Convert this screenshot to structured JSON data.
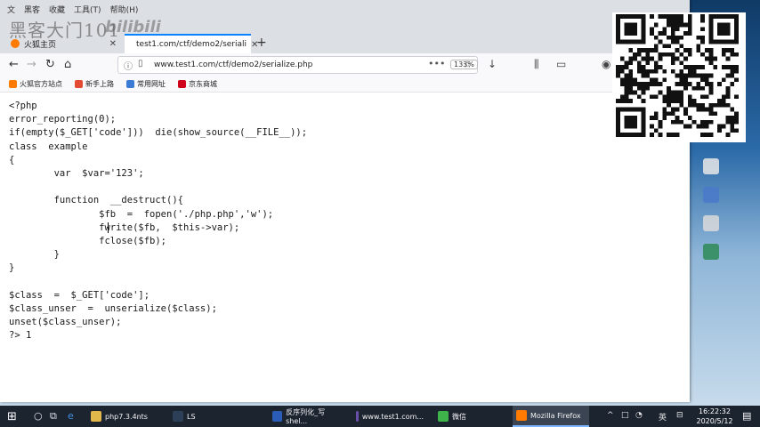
{
  "window": {
    "menu": [
      "文",
      "黑客",
      "收藏",
      "工具(T)",
      "帮助(H)"
    ],
    "watermark": "黑客大门101",
    "watermark_logo": "bilibili"
  },
  "tabs": [
    {
      "label": "火狐主页",
      "active": false,
      "icon": "firefox-icon"
    },
    {
      "label": "test1.com/ctf/demo2/seriali",
      "active": true,
      "icon": "page-icon"
    }
  ],
  "navbar": {
    "url": "www.test1.com/ctf/demo2/serialize.php",
    "zoom": "133%",
    "dots": "•••"
  },
  "bookmarks": [
    {
      "label": "火狐官方站点",
      "color": "#ff7a00"
    },
    {
      "label": "新手上路",
      "color": "#e34b32"
    },
    {
      "label": "常用网址",
      "color": "#3c7bd4"
    },
    {
      "label": "京东商城",
      "color": "#d0021b"
    }
  ],
  "code_lines": [
    "<?php",
    "error_reporting(0);",
    "if(empty($_GET['code']))  die(show_source(__FILE__));",
    "class  example",
    "{",
    "        var  $var='123';",
    "",
    "        function  __destruct(){",
    "                $fb  =  fopen('./php.php','w');",
    "                fwrite($fb,  $this->var);",
    "                fclose($fb);",
    "        }",
    "}",
    "",
    "$class  =  $_GET['code'];",
    "$class_unser  =  unserialize($class);",
    "unset($class_unser);",
    "?> 1"
  ],
  "taskbar": {
    "apps": [
      {
        "label": "php7.3.4nts",
        "color": "#e2b84a",
        "active": false
      },
      {
        "label": "LS",
        "color": "#2d3e58",
        "active": false
      },
      {
        "label": "反序列化_写shel...",
        "color": "#2b5db8",
        "active": false
      },
      {
        "label": "www.test1.com...",
        "color": "#6a4fa8",
        "active": false
      },
      {
        "label": "微信",
        "color": "#3db34a",
        "active": false
      },
      {
        "label": "Mozilla Firefox",
        "color": "#ff7a00",
        "active": true
      }
    ],
    "tray": [
      "^",
      "□",
      "◔",
      "英",
      "⊟"
    ],
    "time": "16:22:32",
    "date": "2020/5/12"
  }
}
